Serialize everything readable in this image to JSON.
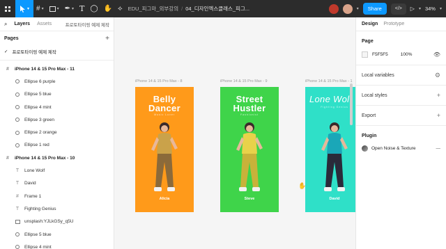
{
  "toolbar": {
    "file_project": "EDU_피그마_외부강의",
    "file_name": "04_디자인엑스클래스_피그...",
    "share_label": "Share",
    "dev_label": "</>",
    "zoom": "34%"
  },
  "left_panel": {
    "tabs": [
      "Layers",
      "Assets"
    ],
    "project_name": "프로토타이핑 예제 제작",
    "pages_label": "Pages",
    "current_page": "프로토타이핑 예제 제작",
    "layers": [
      {
        "type": "frame",
        "label": "iPhone 14 & 15 Pro Max - 11"
      },
      {
        "type": "ellipse",
        "label": "Ellipse 6 purple"
      },
      {
        "type": "ellipse",
        "label": "Ellipse 5 blue"
      },
      {
        "type": "ellipse",
        "label": "Ellipse 4 mint"
      },
      {
        "type": "ellipse",
        "label": "Ellipse 3 green"
      },
      {
        "type": "ellipse",
        "label": "Ellipse 2 orange"
      },
      {
        "type": "ellipse",
        "label": "Ellipse 1 red"
      },
      {
        "type": "frame",
        "label": "iPhone 14 & 15 Pro Max - 10"
      },
      {
        "type": "text",
        "label": "Lone Wolf"
      },
      {
        "type": "text",
        "label": "David"
      },
      {
        "type": "frame-child",
        "label": "Frame 1"
      },
      {
        "type": "text",
        "label": "Fighting Genius"
      },
      {
        "type": "image",
        "label": "unsplash:YJLkGSy_q5U"
      },
      {
        "type": "ellipse",
        "label": "Ellipse 5 blue"
      },
      {
        "type": "ellipse",
        "label": "Ellipse 4 mint"
      }
    ]
  },
  "canvas": {
    "frames": [
      {
        "label": "iPhone 14 & 15 Pro Max - 8",
        "title_line1": "Belly",
        "title_line2": "Dancer",
        "subtitle": "Music Lover",
        "name": "Alicia",
        "bg": "#ff9a1a"
      },
      {
        "label": "iPhone 14 & 15 Pro Max - 9",
        "title_line1": "Street",
        "title_line2": "Hustler",
        "subtitle": "Fashionist",
        "name": "Steve",
        "bg": "#3fd44a"
      },
      {
        "label": "iPhone 14 & 15 Pro Max - 1",
        "title_line1": "Lone Wol",
        "title_line2": "",
        "subtitle": "Fighting Genius",
        "name": "David",
        "bg": "#2fe0c8"
      }
    ]
  },
  "right_panel": {
    "tabs": [
      "Design",
      "Prototype"
    ],
    "page_label": "Page",
    "page_color": "F5F5F5",
    "page_opacity": "100%",
    "local_variables": "Local variables",
    "local_styles": "Local styles",
    "export": "Export",
    "plugin_label": "Plugin",
    "plugin_name": "Open Noise & Texture"
  }
}
